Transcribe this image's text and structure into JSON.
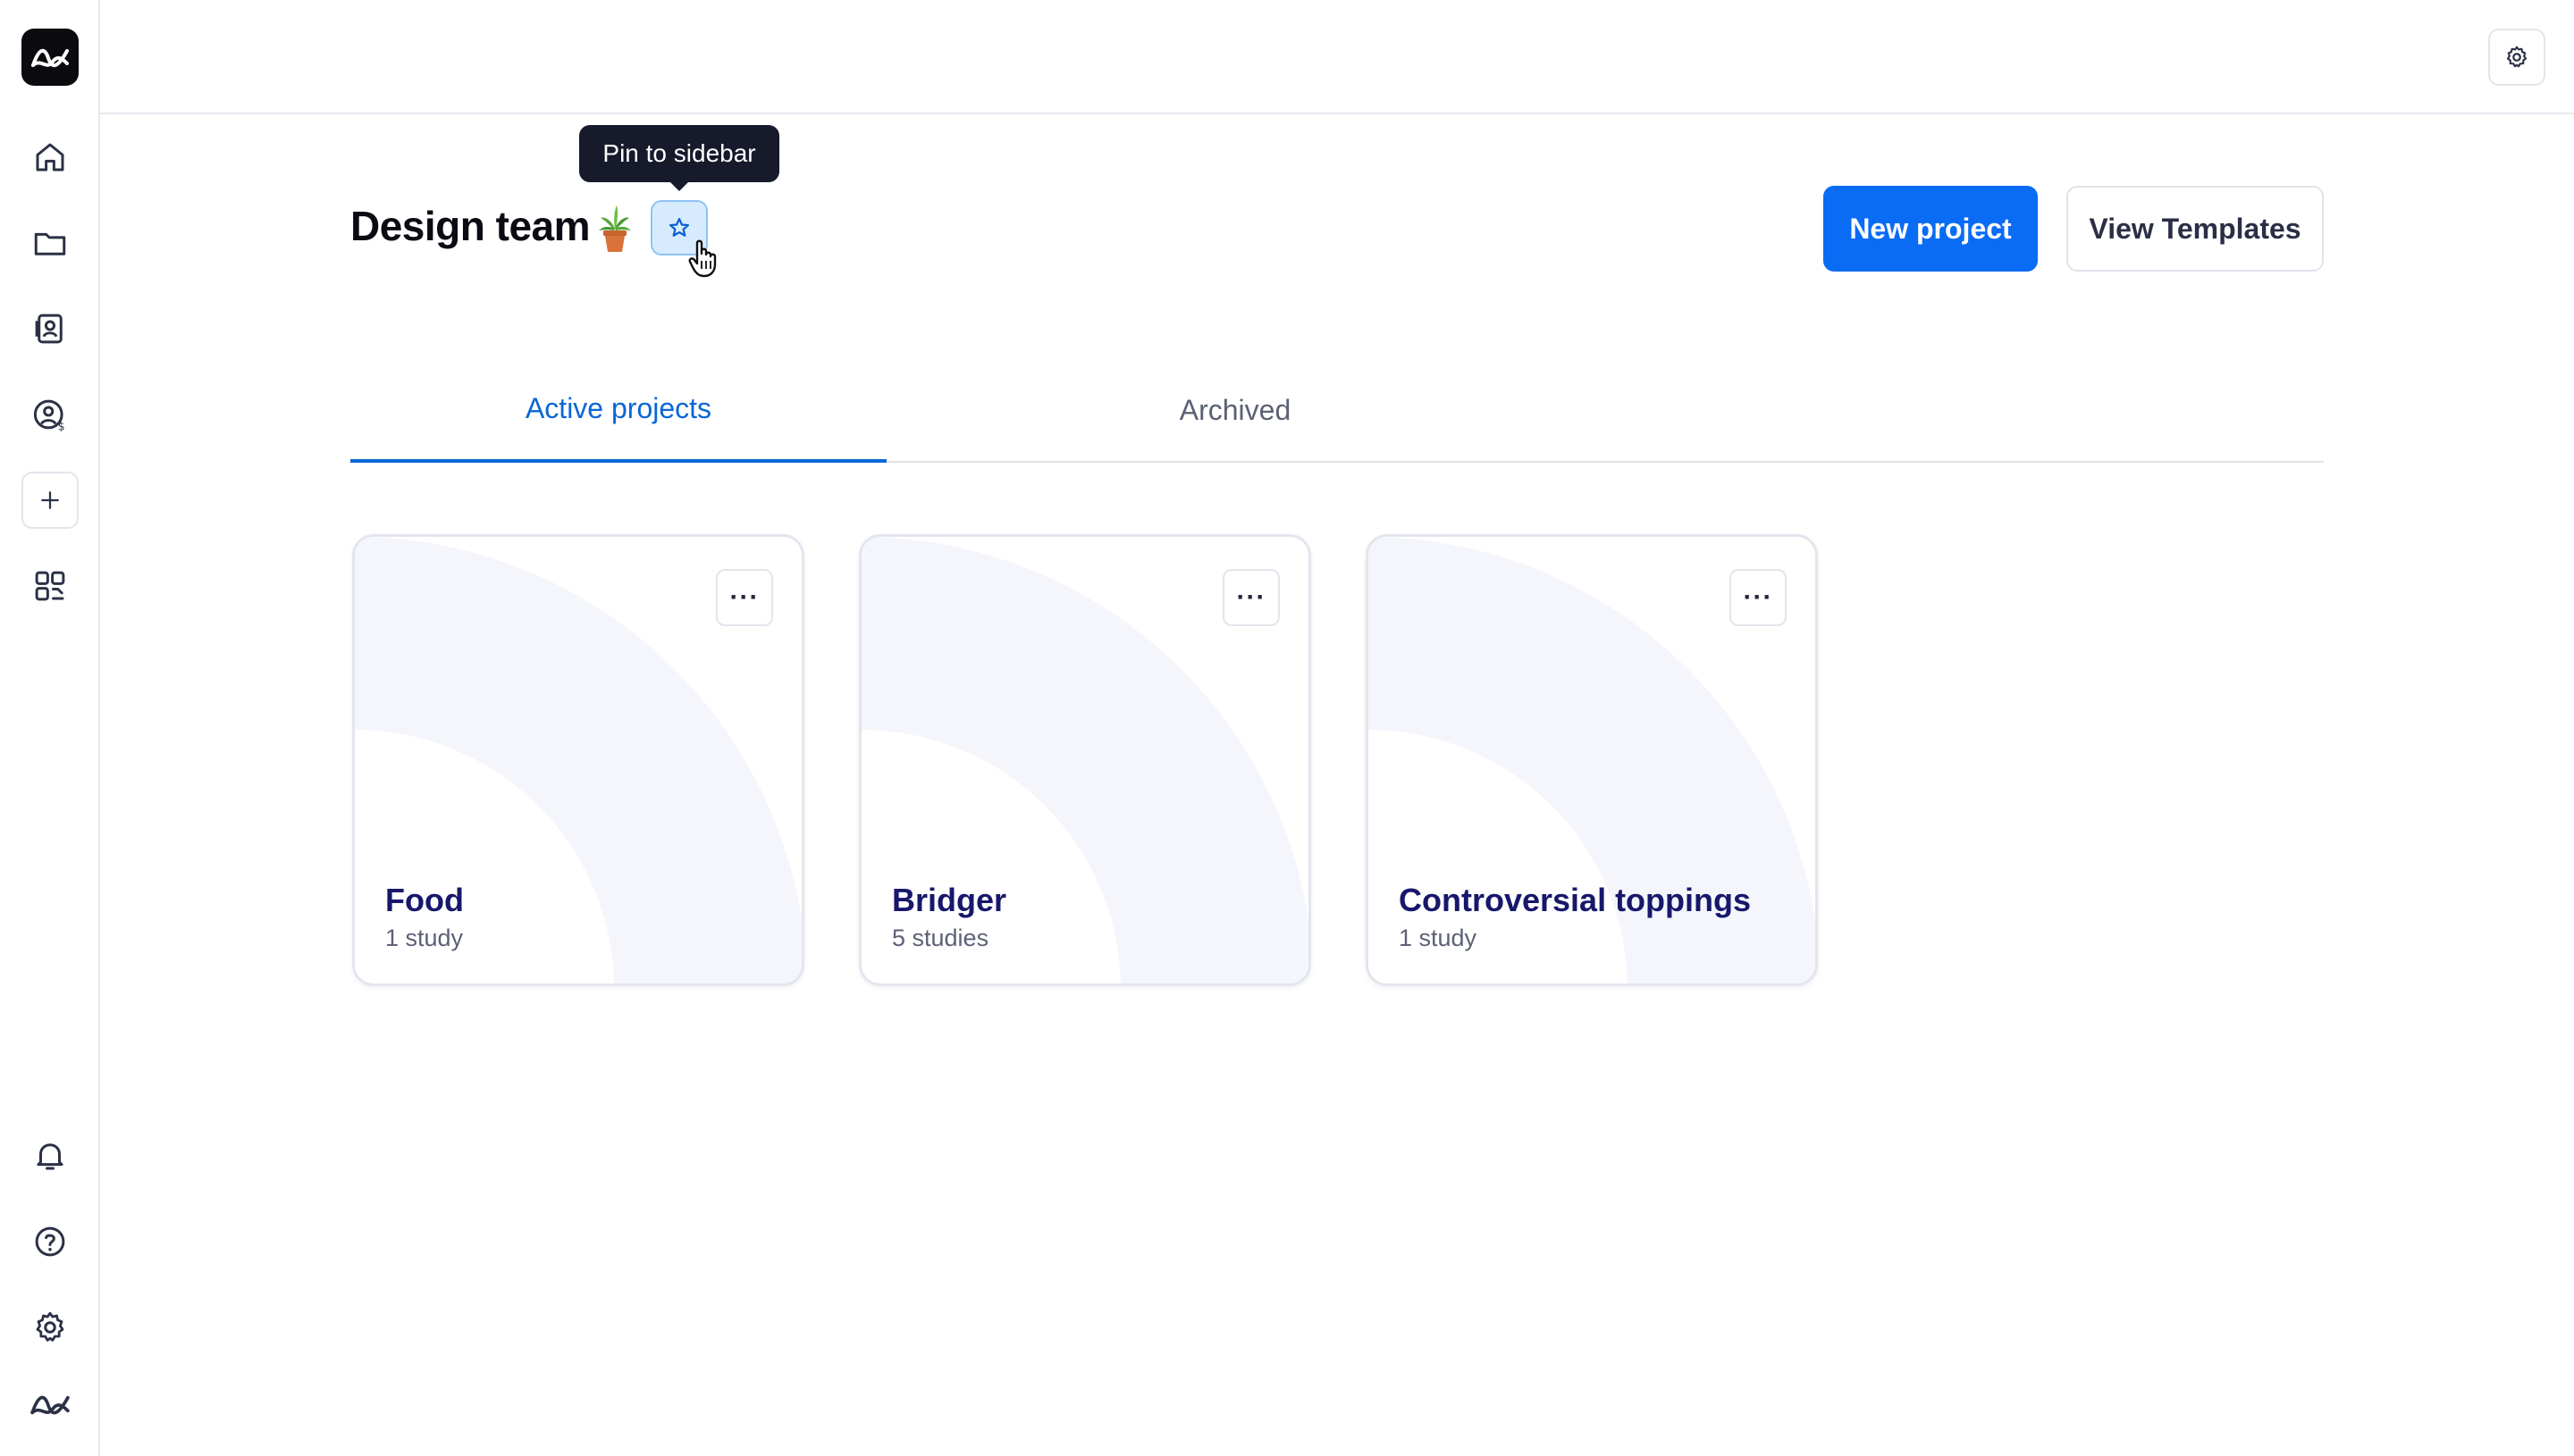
{
  "app": {
    "logo_icon": "app-logo-icon",
    "accent": "#0a6cf5"
  },
  "sidebar": {
    "top_items": [
      {
        "icon": "home-icon"
      },
      {
        "icon": "folder-icon"
      },
      {
        "icon": "contacts-icon"
      },
      {
        "icon": "user-billing-icon"
      },
      {
        "icon": "plus-icon"
      },
      {
        "icon": "apps-icon"
      }
    ],
    "bottom_items": [
      {
        "icon": "bell-icon"
      },
      {
        "icon": "help-icon"
      },
      {
        "icon": "gear-icon"
      },
      {
        "icon": "brand-icon"
      }
    ]
  },
  "header": {
    "title": "Design team",
    "title_emoji": "potted-plant",
    "pin_tooltip": "Pin to sidebar",
    "new_project_label": "New project",
    "view_templates_label": "View Templates"
  },
  "tabs": [
    {
      "label": "Active projects",
      "active": true
    },
    {
      "label": "Archived",
      "active": false
    }
  ],
  "projects": [
    {
      "name": "Food",
      "count": "1 study"
    },
    {
      "name": "Bridger",
      "count": "5 studies"
    },
    {
      "name": "Controversial toppings",
      "count": "1 study"
    }
  ],
  "card_menu_label": "···"
}
